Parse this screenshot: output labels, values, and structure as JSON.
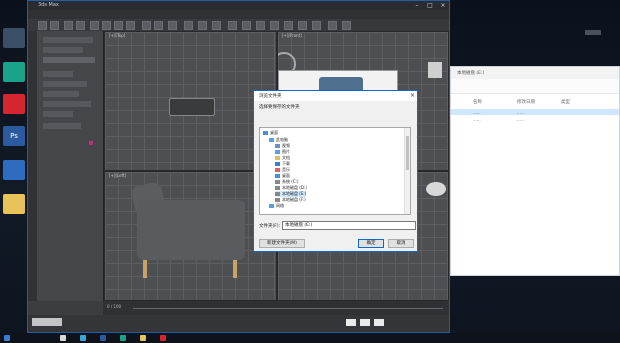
{
  "desktop": {
    "icons": [
      {
        "name": "recycle-bin",
        "color": "#9ab8d8"
      },
      {
        "name": "app-green",
        "color": "#1aa38a"
      },
      {
        "name": "app-red",
        "color": "#d3262f"
      },
      {
        "name": "photoshop",
        "color": "#2b5b9e",
        "glyph": "Ps"
      },
      {
        "name": "app-blue",
        "color": "#2e6cc0"
      },
      {
        "name": "folder",
        "color": "#e8c35a"
      }
    ],
    "top_right_text": "......"
  },
  "max": {
    "title": "3ds Max",
    "viewports": [
      "[+][Top]",
      "[+][Front]",
      "[+][Left]",
      "[+][Perspective]"
    ],
    "timeline": "0 / 100"
  },
  "dialog": {
    "title": "浏览文件夹",
    "description": "选择要保存的文件夹",
    "tree": [
      {
        "label": "桌面",
        "level": 0,
        "icon": "#4a90d8"
      },
      {
        "label": "此电脑",
        "level": 1,
        "icon": "#5aa0e0"
      },
      {
        "label": "视频",
        "level": 2,
        "icon": "#6f8fc8"
      },
      {
        "label": "图片",
        "level": 2,
        "icon": "#5aa0e0"
      },
      {
        "label": "文档",
        "level": 2,
        "icon": "#e0c060"
      },
      {
        "label": "下载",
        "level": 2,
        "icon": "#3a80d0"
      },
      {
        "label": "音乐",
        "level": 2,
        "icon": "#e06060"
      },
      {
        "label": "桌面",
        "level": 2,
        "icon": "#4a90d8"
      },
      {
        "label": "系统 (C:)",
        "level": 2,
        "icon": "#888888"
      },
      {
        "label": "本地磁盘 (D:)",
        "level": 2,
        "icon": "#888888"
      },
      {
        "label": "本地磁盘 (E:)",
        "level": 2,
        "icon": "#888888",
        "selected": true
      },
      {
        "label": "本地磁盘 (F:)",
        "level": 2,
        "icon": "#888888"
      },
      {
        "label": "网络",
        "level": 1,
        "icon": "#5aa0e0"
      }
    ],
    "folder_label": "文件夹(F):",
    "folder_value": "本地磁盘 (E:)",
    "new_folder_button": "新建文件夹(M)",
    "ok_button": "确定",
    "cancel_button": "取消"
  },
  "explorer": {
    "title": "本地磁盘 (E:)",
    "columns": [
      "名称",
      "修改日期",
      "类型"
    ],
    "rows": [
      [
        "......",
        "......",
        "......"
      ],
      [
        "......",
        "......",
        "......"
      ]
    ]
  },
  "accent": "#0b6bd0"
}
